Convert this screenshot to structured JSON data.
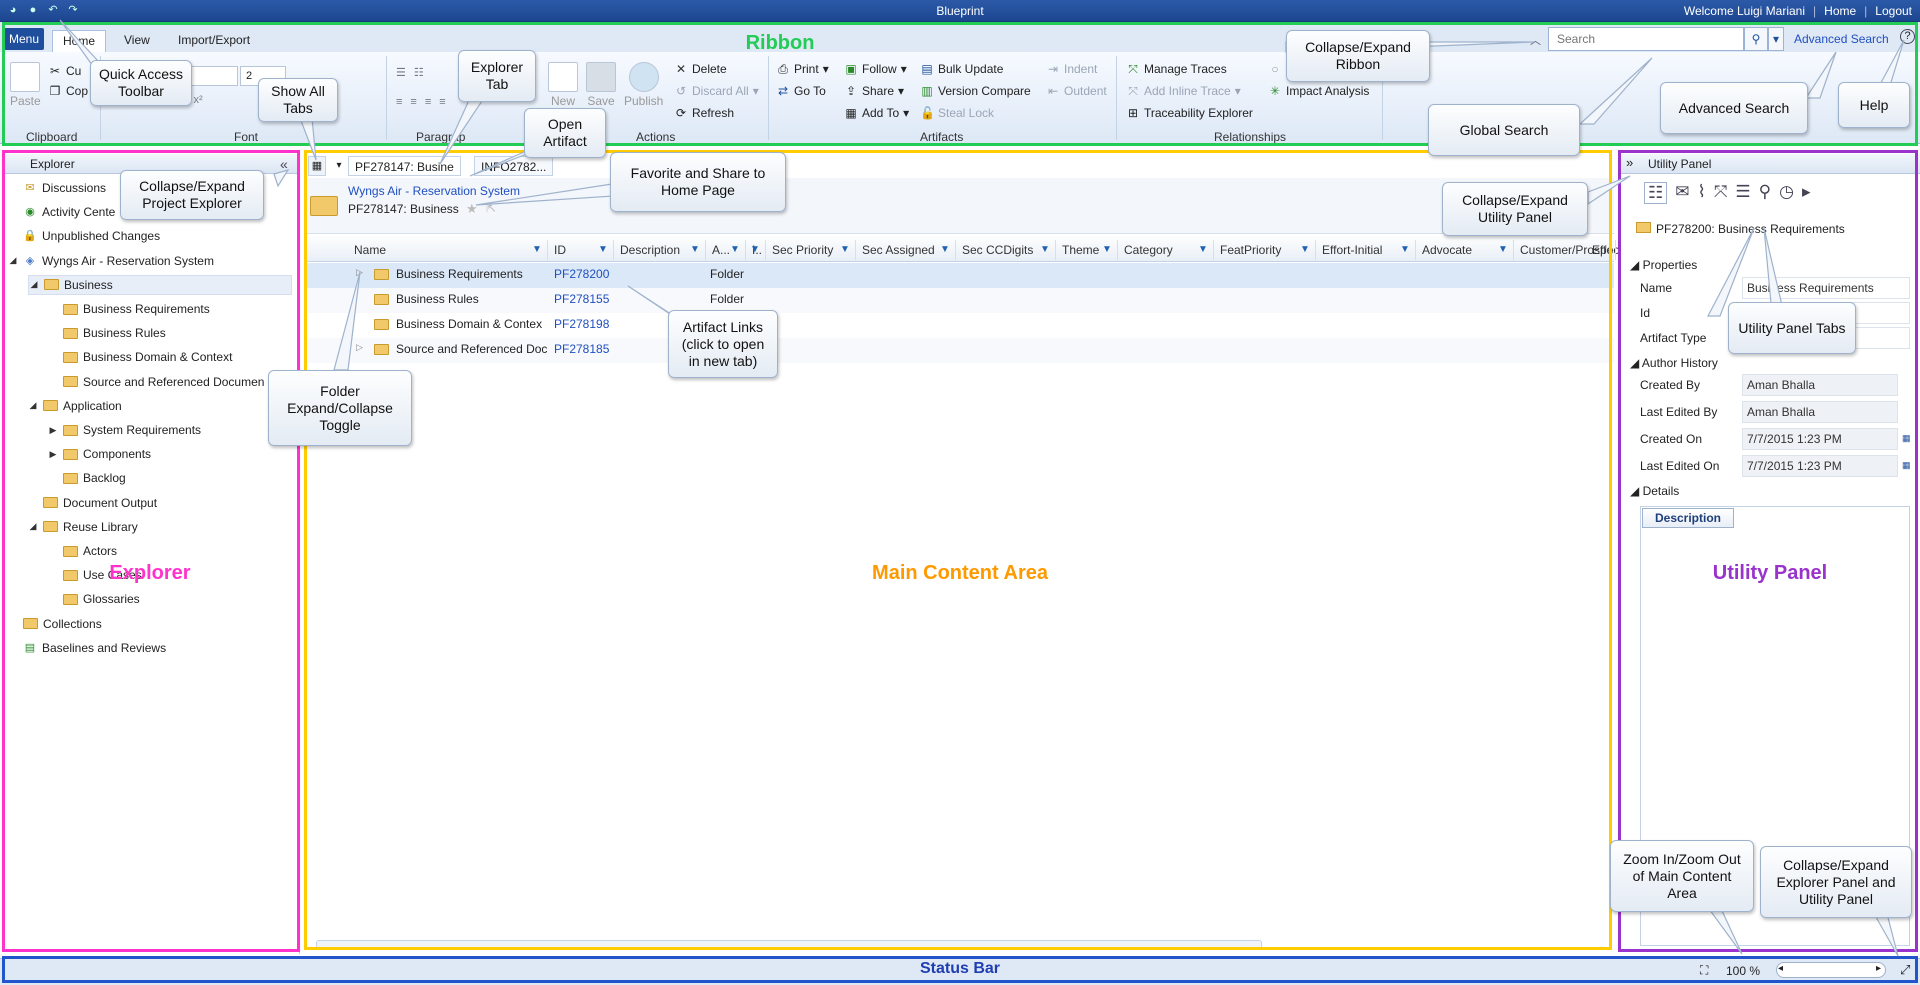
{
  "app": {
    "title": "Blueprint",
    "welcome": "Welcome Luigi Mariani",
    "home": "Home",
    "logout": "Logout"
  },
  "ribbon": {
    "menu": "Menu",
    "tabs": [
      "Home",
      "View",
      "Import/Export"
    ],
    "groups": {
      "clipboard": "Clipboard",
      "font": "Font",
      "paragraph": "Paragrap",
      "actions": "Actions",
      "artifacts": "Artifacts",
      "relationships": "Relationships"
    },
    "clipboard": {
      "paste": "Paste",
      "cut": "Cu",
      "copy": "Cop"
    },
    "font": {
      "size": "2"
    },
    "actions": {
      "new": "New",
      "save": "Save",
      "publish": "Publish",
      "delete": "Delete",
      "discard_all": "Discard All",
      "refresh": "Refresh",
      "print": "Print",
      "go_to": "Go To"
    },
    "artifacts": {
      "follow": "Follow",
      "share": "Share",
      "add_to": "Add To",
      "bulk_update": "Bulk Update",
      "version_compare": "Version Compare",
      "steal_lock": "Steal Lock",
      "indent": "Indent",
      "outdent": "Outdent"
    },
    "relationships": {
      "manage_traces": "Manage Traces",
      "add_inline_trace": "Add Inline Trace",
      "traceability_explorer": "Traceability Explorer",
      "impact_analysis": "Impact Analysis"
    },
    "search_placeholder": "Search",
    "advanced_search": "Advanced Search"
  },
  "explorer": {
    "title": "Explorer",
    "items": [
      {
        "label": "Discussions"
      },
      {
        "label": "Activity Cente"
      },
      {
        "label": "Unpublished Changes"
      },
      {
        "label": "Wyngs Air - Reservation System"
      },
      {
        "label": "Business"
      },
      {
        "label": "Business Requirements"
      },
      {
        "label": "Business Rules"
      },
      {
        "label": "Business Domain & Context"
      },
      {
        "label": "Source and Referenced Documen"
      },
      {
        "label": "Application"
      },
      {
        "label": "System Requirements"
      },
      {
        "label": "Components"
      },
      {
        "label": "Backlog"
      },
      {
        "label": "Document Output"
      },
      {
        "label": "Reuse Library"
      },
      {
        "label": "Actors"
      },
      {
        "label": "Use Cases"
      },
      {
        "label": "Glossaries"
      },
      {
        "label": "Collections"
      },
      {
        "label": "Baselines and Reviews"
      }
    ]
  },
  "main": {
    "tabs": [
      "PF278147: Busine",
      "INFO2782..."
    ],
    "breadcrumb": "Wyngs Air - Reservation System",
    "artifact_title": "PF278147: Business",
    "columns": [
      "Name",
      "ID",
      "Description",
      "A...",
      "I..",
      "Sec Priority",
      "Sec Assigned",
      "Sec CCDigits",
      "Theme",
      "Category",
      "FeatPriority",
      "Effort-Initial",
      "Advocate",
      "Customer/Prospect",
      "Effo"
    ],
    "rows": [
      {
        "name": "Business Requirements",
        "id": "PF278200",
        "type": "Folder"
      },
      {
        "name": "Business Rules",
        "id": "PF278155",
        "type": "Folder"
      },
      {
        "name": "Business Domain & Contex",
        "id": "PF278198",
        "type": ""
      },
      {
        "name": "Source and Referenced Doc",
        "id": "PF278185",
        "type": ""
      }
    ]
  },
  "utility": {
    "title": "Utility Panel",
    "artifact": "PF278200: Business Requirements",
    "sections": {
      "properties": "Properties",
      "author_history": "Author History",
      "details": "Details"
    },
    "props": {
      "name_label": "Name",
      "name_value": "Business Requirements",
      "id_label": "Id",
      "type_label": "Artifact Type"
    },
    "history": [
      {
        "label": "Created By",
        "value": "Aman Bhalla"
      },
      {
        "label": "Last Edited By",
        "value": "Aman Bhalla"
      },
      {
        "label": "Created On",
        "value": "7/7/2015 1:23 PM"
      },
      {
        "label": "Last Edited On",
        "value": "7/7/2015 1:23 PM"
      }
    ],
    "description_tab": "Description"
  },
  "status": {
    "zoom": "100 %"
  },
  "annotations": {
    "zones": {
      "ribbon": "Ribbon",
      "explorer": "Explorer",
      "main": "Main Content Area",
      "utility": "Utility Panel",
      "status": "Status Bar"
    },
    "callouts": {
      "quick_access": "Quick Access\nToolbar",
      "show_all_tabs": "Show All\nTabs",
      "explorer_tab": "Explorer\nTab",
      "open_artifact": "Open\nArtifact",
      "collapse_ribbon": "Collapse/Expand\nRibbon",
      "advanced_search": "Advanced Search",
      "help": "Help",
      "global_search": "Global Search",
      "collapse_explorer": "Collapse/Expand\nProject Explorer",
      "favorite_share": "Favorite and Share to\nHome Page",
      "collapse_utility": "Collapse/Expand\nUtility Panel",
      "artifact_links": "Artifact Links\n(click to open\nin new tab)",
      "folder_toggle": "Folder\nExpand/Collapse\nToggle",
      "utility_tabs": "Utility Panel Tabs",
      "zoom": "Zoom In/Zoom Out\nof Main Content\nArea",
      "collapse_both": "Collapse/Expand\nExplorer Panel and\nUtility Panel"
    }
  },
  "colors": {
    "ribbon_zone": "#22cc55",
    "explorer_zone": "#ff33cc",
    "main_zone": "#ffcc00",
    "utility_zone": "#9933cc",
    "status_zone": "#2255cc"
  }
}
